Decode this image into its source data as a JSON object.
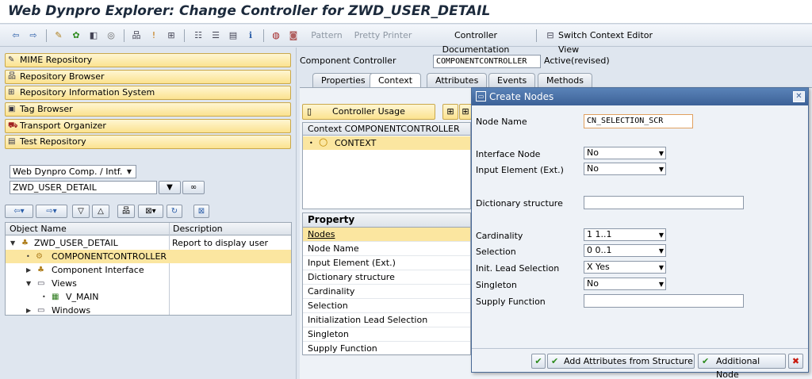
{
  "window": {
    "title": "Web Dynpro Explorer: Change Controller for ZWD_USER_DETAIL"
  },
  "toolbar": {
    "pattern": "Pattern",
    "pretty_printer": "Pretty Printer",
    "controller_documentation": "Controller Documentation",
    "switch_context_editor": "Switch Context Editor View"
  },
  "nav": {
    "items": [
      {
        "label": "MIME Repository",
        "icon": "mime-icon"
      },
      {
        "label": "Repository Browser",
        "icon": "repository-browser-icon"
      },
      {
        "label": "Repository Information System",
        "icon": "info-system-icon"
      },
      {
        "label": "Tag Browser",
        "icon": "tag-browser-icon"
      },
      {
        "label": "Transport Organizer",
        "icon": "transport-icon"
      },
      {
        "label": "Test Repository",
        "icon": "test-repository-icon"
      }
    ]
  },
  "object_type_select": {
    "value": "Web Dynpro Comp. / Intf."
  },
  "object_name_input": {
    "value": "ZWD_USER_DETAIL"
  },
  "object_tree": {
    "columns": [
      "Object Name",
      "Description"
    ],
    "rows": [
      {
        "name": "ZWD_USER_DETAIL",
        "description": "Report to display user details"
      },
      {
        "name": "COMPONENTCONTROLLER",
        "description": ""
      },
      {
        "name": "Component Interface",
        "description": ""
      },
      {
        "name": "Views",
        "description": ""
      },
      {
        "name": "V_MAIN",
        "description": ""
      },
      {
        "name": "Windows",
        "description": ""
      }
    ]
  },
  "controller": {
    "label": "Component Controller",
    "name": "COMPONENTCONTROLLER",
    "status": "Active(revised)"
  },
  "tabs": [
    {
      "label": "Properties"
    },
    {
      "label": "Context"
    },
    {
      "label": "Attributes"
    },
    {
      "label": "Events"
    },
    {
      "label": "Methods"
    }
  ],
  "context_panel": {
    "controller_usage_button": "Controller Usage",
    "header": "Context COMPONENTCONTROLLER",
    "root_node": "CONTEXT"
  },
  "property_panel": {
    "header": "Property",
    "rows": [
      "Nodes",
      "Node Name",
      "Input Element (Ext.)",
      "Dictionary structure",
      "Cardinality",
      "Selection",
      "Initialization Lead Selection",
      "Singleton",
      "Supply Function"
    ]
  },
  "dialog": {
    "title": "Create Nodes",
    "node_name_label": "Node Name",
    "node_name_value": "CN_SELECTION_SCR",
    "interface_node_label": "Interface Node",
    "interface_node_value": "No",
    "input_element_label": "Input Element (Ext.)",
    "input_element_value": "No",
    "dictionary_structure_label": "Dictionary structure",
    "cardinality_label": "Cardinality",
    "cardinality_value": "1 1..1",
    "selection_label": "Selection",
    "selection_value": "0 0..1",
    "init_lead_selection_label": "Init. Lead Selection",
    "init_lead_selection_value": "X Yes",
    "singleton_label": "Singleton",
    "singleton_value": "No",
    "supply_function_label": "Supply Function",
    "add_attributes_button": "Add Attributes from Structure",
    "additional_node_button": "Additional Node"
  },
  "colors": {
    "selection_highlight": "#fbe6a0",
    "nav_button": "#fbe28f",
    "dialog_caption": "#3c6197"
  }
}
